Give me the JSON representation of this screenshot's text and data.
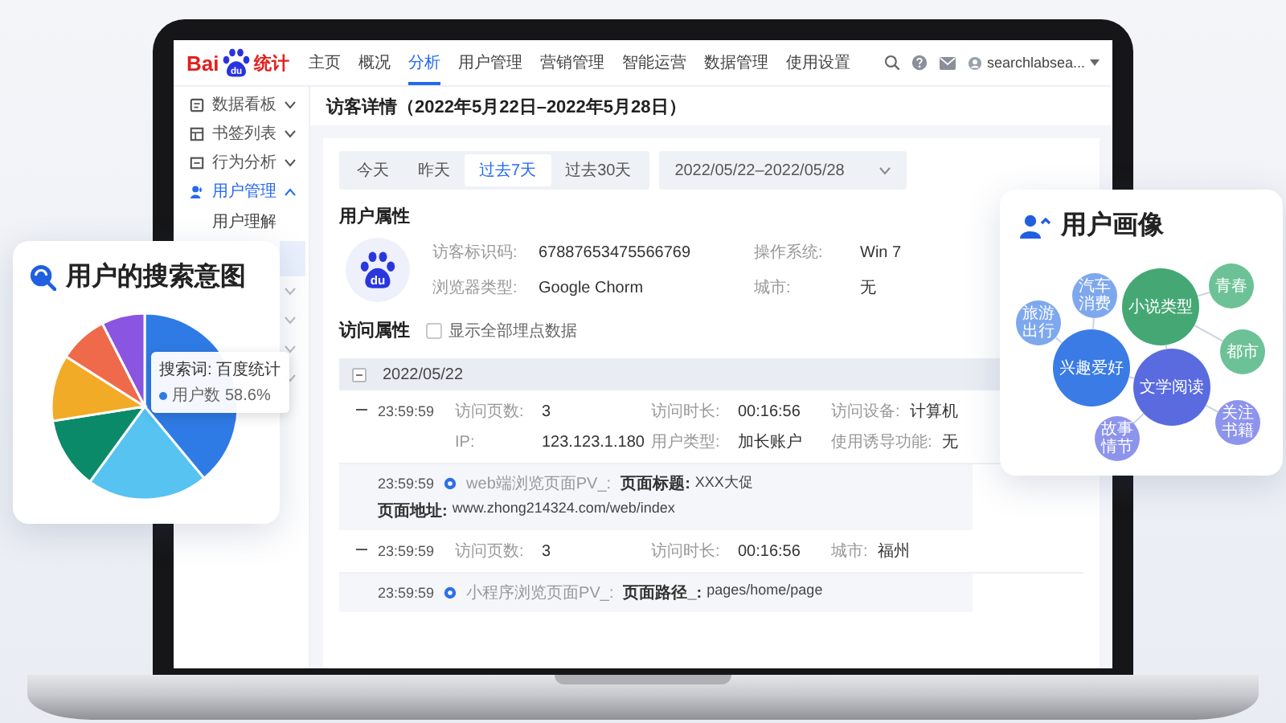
{
  "nav": {
    "logo": {
      "left": "Bai",
      "mark": "du",
      "right": "统计"
    },
    "items": [
      {
        "label": "主页",
        "selected": false
      },
      {
        "label": "概况",
        "selected": false
      },
      {
        "label": "分析",
        "selected": true
      },
      {
        "label": "用户管理",
        "selected": false
      },
      {
        "label": "营销管理",
        "selected": false
      },
      {
        "label": "智能运营",
        "selected": false
      },
      {
        "label": "数据管理",
        "selected": false
      },
      {
        "label": "使用设置",
        "selected": false
      }
    ],
    "user": "searchlabsea..."
  },
  "sidebar": {
    "items": [
      {
        "label": "数据看板",
        "expanded": false
      },
      {
        "label": "书签列表",
        "expanded": false
      },
      {
        "label": "行为分析",
        "expanded": false
      },
      {
        "label": "用户管理",
        "expanded": true,
        "children": [
          {
            "label": "用户理解",
            "selected": false
          },
          {
            "selected": true
          }
        ]
      },
      {
        "expanded": false
      },
      {
        "expanded": false
      },
      {
        "expanded": false
      },
      {
        "expanded": false
      }
    ]
  },
  "page_title": "访客详情（2022年5月22日–2022年5月28日）",
  "date_tabs": [
    {
      "label": "今天",
      "selected": false
    },
    {
      "label": "昨天",
      "selected": false
    },
    {
      "label": "过去7天",
      "selected": true
    },
    {
      "label": "过去30天",
      "selected": false
    }
  ],
  "date_range": "2022/05/22–2022/05/28",
  "user_attributes": {
    "heading": "用户属性",
    "avatar_mark": "du",
    "fields": [
      {
        "label": "访客标识码:",
        "value": "67887653475566769"
      },
      {
        "label": "操作系统:",
        "value": "Win 7"
      },
      {
        "label": "浏览器类型:",
        "value": "Google Chorm"
      },
      {
        "label": "城市:",
        "value": "无"
      }
    ]
  },
  "visit_attributes": {
    "heading": "访问属性",
    "show_all": {
      "label": "显示全部埋点数据",
      "checked": false
    },
    "group": {
      "date": "2022/05/22",
      "expanded": true
    },
    "rows": [
      {
        "kind": "visit",
        "expanded": true,
        "time": "23:59:59",
        "fields": [
          {
            "label": "访问页数:",
            "value": "3"
          },
          {
            "label": "访问时长:",
            "value": "00:16:56"
          },
          {
            "label": "访问设备:",
            "value": "计算机"
          },
          {
            "label": "IP:",
            "value": "123.123.1.180"
          },
          {
            "label": "用户类型:",
            "value": "加长账户"
          },
          {
            "label": "使用诱导功能:",
            "value": "无"
          }
        ]
      },
      {
        "kind": "event",
        "time": "23:59:59",
        "type": "web端浏览页面PV_:",
        "parts": [
          {
            "label": "页面标题:",
            "value": "XXX大促"
          },
          {
            "label": "页面地址:",
            "value": "www.zhong214324.com/web/index"
          }
        ]
      },
      {
        "kind": "visit",
        "expanded": true,
        "time": "23:59:59",
        "fields": [
          {
            "label": "访问页数:",
            "value": "3"
          },
          {
            "label": "访问时长:",
            "value": "00:16:56"
          },
          {
            "label": "城市:",
            "value": "福州"
          }
        ]
      },
      {
        "kind": "event",
        "time": "23:59:59",
        "type": "小程序浏览页面PV_:",
        "parts": [
          {
            "label": "页面路径_:",
            "value": "pages/home/page"
          }
        ]
      }
    ]
  },
  "search_intent_card": {
    "title": "用户的搜索意图",
    "tooltip": {
      "title": "搜索词: 百度统计",
      "series": "用户数",
      "value": "58.6%"
    }
  },
  "persona_card": {
    "title": "用户画像",
    "graph": {
      "label": "兴趣爱好",
      "color": "#3a7be6",
      "children": [
        {
          "label": "旅游出行",
          "color": "#7ea8ee"
        },
        {
          "label": "汽车消费",
          "color": "#7ea8ee"
        },
        {
          "label": "文学阅读",
          "color": "#5a6be0",
          "children": [
            {
              "label": "故事情节",
              "color": "#8d94ec"
            },
            {
              "label": "关注书籍",
              "color": "#8d94ec"
            },
            {
              "label": "小说类型",
              "color": "#45a874",
              "children": [
                {
                  "label": "青春",
                  "color": "#6cc296"
                },
                {
                  "label": "都市",
                  "color": "#6cc296"
                }
              ]
            }
          ]
        }
      ]
    }
  }
}
